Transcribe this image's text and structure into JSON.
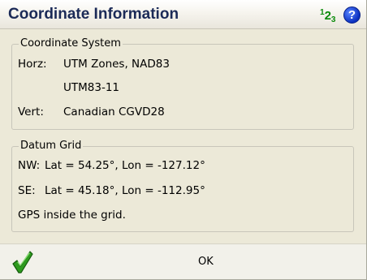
{
  "window": {
    "title": "Coordinate Information",
    "input_mode": {
      "sup": "1",
      "mid": "2",
      "sub": "3"
    },
    "help_label": "?"
  },
  "coordinate_system": {
    "legend": "Coordinate System",
    "horz_label": "Horz:",
    "horz_value": "UTM Zones, NAD83",
    "horz_zone": "UTM83-11",
    "vert_label": "Vert:",
    "vert_value": "Canadian CGVD28"
  },
  "datum_grid": {
    "legend": "Datum Grid",
    "nw": {
      "label": "NW:",
      "value": "Lat = 54.25°, Lon = -127.12°"
    },
    "se": {
      "label": "SE:",
      "value": "Lat = 45.18°, Lon = -112.95°"
    },
    "status": "GPS inside the grid."
  },
  "footer": {
    "ok_label": "OK",
    "check_icon": "checkmark-icon"
  },
  "colors": {
    "title_text": "#1b2a57",
    "input_mode_green": "#0a8a0a",
    "help_blue": "#0a2fbf",
    "background": "#ece9d8",
    "checkmark_green": "#2e9b1e"
  }
}
